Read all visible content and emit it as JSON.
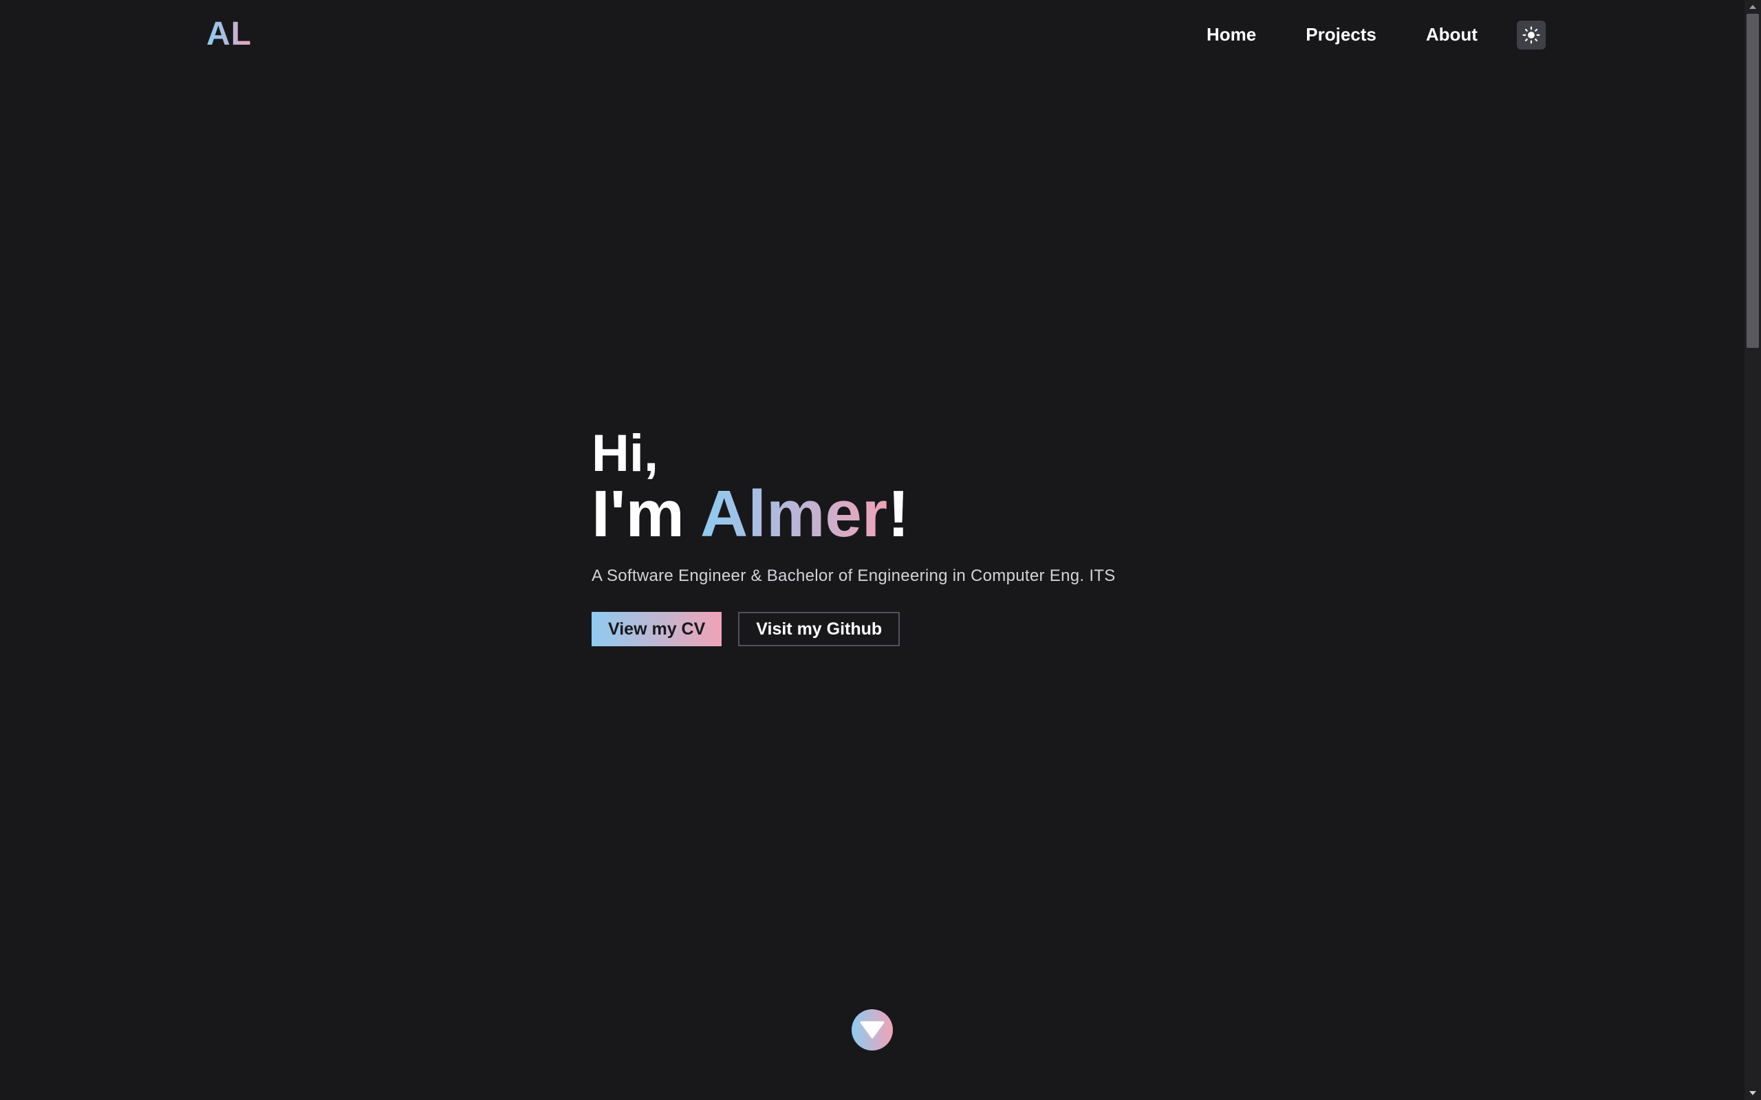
{
  "header": {
    "logo": "AL",
    "nav": {
      "home": "Home",
      "projects": "Projects",
      "about": "About"
    },
    "theme_toggle_icon": "sun-icon"
  },
  "hero": {
    "greeting": "Hi,",
    "intro_prefix": "I'm ",
    "name": "Almer",
    "intro_suffix": "!",
    "subtitle": "A Software Engineer & Bachelor of Engineering in Computer Eng. ITS",
    "buttons": {
      "cv": "View my CV",
      "github": "Visit my Github"
    }
  },
  "scroll_down_icon": "chevron-down-icon",
  "colors": {
    "background": "#18181b",
    "gradient_start": "#8ecbf0",
    "gradient_end": "#f0a3b6",
    "toggle_bg": "#3f3f46"
  }
}
